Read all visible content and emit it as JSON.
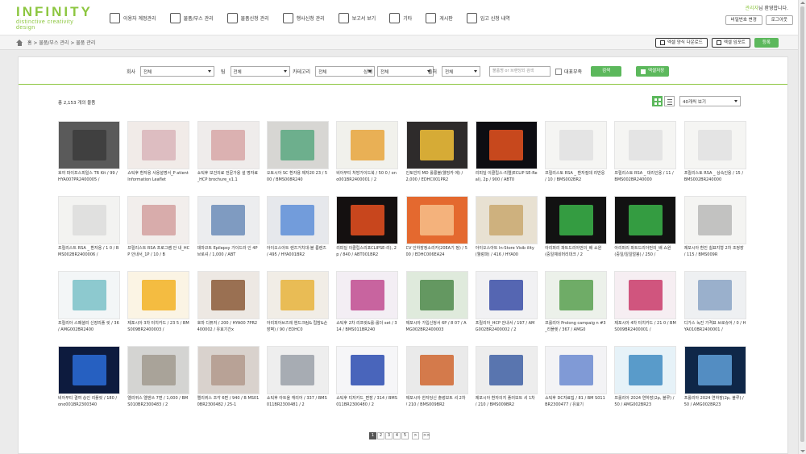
{
  "app": {
    "logo": "INFINITY",
    "tagline": "distinctive creativity design"
  },
  "nav": [
    {
      "label": "이용자 계정관리",
      "icon": "user-icon"
    },
    {
      "label": "물품/부스 관리",
      "icon": "map-icon"
    },
    {
      "label": "물품신청 관리",
      "icon": "box-icon"
    },
    {
      "label": "행사신청 관리",
      "icon": "calendar-icon"
    },
    {
      "label": "보고서 보기",
      "icon": "report-icon"
    },
    {
      "label": "기타",
      "icon": "tool-icon"
    },
    {
      "label": "게시판",
      "icon": "board-icon"
    },
    {
      "label": "입고 신청 내역",
      "icon": "cart-icon"
    }
  ],
  "user": {
    "name": "관리자",
    "welcome_suffix": "님 환영합니다.",
    "change_pw": "비밀번호 변경",
    "logout": "로그아웃"
  },
  "breadcrumb": "홈 > 물품/부스 관리 > 물품 관리",
  "toolbar": {
    "excel_download": "엑셀 양식 다운로드",
    "excel_import": "엑셀 임포트",
    "register": "등록"
  },
  "filters": {
    "company": {
      "label": "회사",
      "value": "전체"
    },
    "team": {
      "label": "팀",
      "value": "전체"
    },
    "category": {
      "label": "카테고리",
      "value": "전체"
    },
    "status": {
      "label": "상태",
      "value": "전체"
    },
    "warehouse": {
      "label": "출처",
      "value": "전체"
    },
    "search_placeholder": "물품명 or 브랜딩되 검색",
    "representative": "대표부족",
    "search_btn": "검색",
    "excel_btn": "엑셀저장"
  },
  "list": {
    "total": "총 2,153 개의 물품",
    "per_page": "40개씩 보기"
  },
  "products": [
    {
      "caption": "호야 파이프스피일스 TR Kit / 99 / HYA007PR2400005 /",
      "thumb": "#5a5a5a",
      "fg": "#3c3c3c"
    },
    {
      "caption": "쇼틱후 환자용 사용설명서_P atient Information Leaflet",
      "thumb": "#f1ebe8",
      "fg": "#d9b5ba"
    },
    {
      "caption": "쇼틱후 보건의료 전문가용 설 명자료_HCP brochure_v1.1",
      "thumb": "#efeceb",
      "fg": "#d7a7a7"
    },
    {
      "caption": "오토시아 SC 환자용 제자20 23 / 500 / BMS008R240",
      "thumb": "#d7d6d3",
      "fg": "#5aa880"
    },
    {
      "caption": "비아부티 처방가이드북 / 50 0 / ono001BR2400001 / 2",
      "thumb": "#f1f1ec",
      "fg": "#e8a53b"
    },
    {
      "caption": "인토빈지 MD 롤롱볼(웰빙카 에) / 2,000 / EDHC001PR2",
      "thumb": "#2e2b2b",
      "fg": "#f3c238"
    },
    {
      "caption": "리피딜 이클립스-리엘(ECLIP SE-Real), 2p / 900 / ABT0",
      "thumb": "#0d0d12",
      "fg": "#e95420"
    },
    {
      "caption": "프릴리스토 RSA _ 환자질데 리반응 / 10 / BMS002BR2",
      "thumb": "#f5f5f3",
      "fg": "#e1e1e1"
    },
    {
      "caption": "프릴리스토 RSA _ 대리인용 / 11 / BMS002BR240000",
      "thumb": "#f5f5f3",
      "fg": "#e1e1e1"
    },
    {
      "caption": "프릴리스토 RSA _ 상속인용 / 15 / BMS002BR240000",
      "thumb": "#f5f5f3",
      "fg": "#e1e1e1"
    },
    {
      "caption": "프릴리스트 RSA _ 환자용 / 1 0 / BMS002BR2400006 /",
      "thumb": "#f3f3f1",
      "fg": "#dcdcdc"
    },
    {
      "caption": "프릴리스트 RSA 프로그램 안 내_HCP 안내서_1P / 10 / B",
      "thumb": "#f2eeec",
      "fg": "#d3a0a0"
    },
    {
      "caption": "데마코트 Epilepsy 가이드라 인 4P 브로셔 / 1,000 / ABT",
      "thumb": "#ecedef",
      "fg": "#6c8cb9"
    },
    {
      "caption": "아이오스아트 렌즈거치대-블 름렌즈 / 495 / HYA001BR2",
      "thumb": "#e6e8ec",
      "fg": "#5d8ed8"
    },
    {
      "caption": "리피딜 이클립스리포CLIPSE-리), 2p / 840 / ABT001BR2",
      "thumb": "#141010",
      "fg": "#e85020"
    },
    {
      "caption": "CV 인하장정소리카(20EA기 정) / 500 / EDHC006EA24",
      "thumb": "#e4692f",
      "fg": "#f7c08a"
    },
    {
      "caption": "아이오스아트 In-Store Visib ility (웰렁파) / 416 / HYA00",
      "thumb": "#e8e1d2",
      "fg": "#c9a870"
    },
    {
      "caption": "아리퍼리 파트드리아먼의_배 쇼원 (중일예네머리대크 / 2",
      "thumb": "#121212",
      "fg": "#3bb54a"
    },
    {
      "caption": "아리퍼리 파트드리아먼의_배 쇼원 (중일/일일얼봉) / 250 /",
      "thumb": "#121212",
      "fg": "#3bb54a"
    },
    {
      "caption": "제포시아 환진 쉼표지형 2차 조정장 / 115 / BMS009R",
      "thumb": "#f4f4f2",
      "fg": "#b9b9b9"
    },
    {
      "caption": "프릴리아 스페셜리 신장리플 릿 / 36 / AMG002BR2400",
      "thumb": "#f3f6f7",
      "fg": "#7ac1c8"
    },
    {
      "caption": "제포시아 3차 터치카드 / 23 5 / BMS009BR2400003 /",
      "thumb": "#fbf4e4",
      "fg": "#f2b125"
    },
    {
      "caption": "호마 디퓨저 / 200 / HYA00 7PR2400002 / 유효기간x",
      "thumb": "#ede8e3",
      "fg": "#8b5a38"
    },
    {
      "caption": "아리피아브즈레 핸드크림& 립밤&손장벽) / 90 / EDHC0",
      "thumb": "#f1ede6",
      "fg": "#e7b33b"
    },
    {
      "caption": "쇼틱후 2차 리프릿&롤-롤더 set / 314 / BMS011BR240",
      "thumb": "#f3eef4",
      "fg": "#c04b8f"
    },
    {
      "caption": "제포시아 가입신청서 6P / 8 07 / AMG002BR2400003",
      "thumb": "#dfeadc",
      "fg": "#4f8a4b"
    },
    {
      "caption": "프릴리아_HCP 안내서 / 197 / AMG002BR2400002 / 2",
      "thumb": "#f1f1f3",
      "fg": "#3a4da6"
    },
    {
      "caption": "프롤리아 Prolong campaig n #3_리플렛 / 367 / AMG0",
      "thumb": "#ecf1ea",
      "fg": "#59a050"
    },
    {
      "caption": "제포시아 4차 터치카드 / 21 0 / BMS009BR2400001 /",
      "thumb": "#f6eef2",
      "fg": "#c93a6a"
    },
    {
      "caption": "디가스 녹진 가격표 브로슈어 / 0 / HYA010BR2400001 /",
      "thumb": "#eef0f2",
      "fg": "#8ba5c6"
    },
    {
      "caption": "비아부티 결여 승인 리플릿 / 180 / ono001BR2300340",
      "thumb": "#0d1b3e",
      "fg": "#2c6cd8"
    },
    {
      "caption": "엘리퀴스 엘엔쓰 7편 / 1,000 / BMS010BR2300483 / 2",
      "thumb": "#d4d4d2",
      "fg": "#a19a8f"
    },
    {
      "caption": "엘리퀴스 조각 6편 / 940 / B MS010BR2300482 / 25-1",
      "thumb": "#d9d2cd",
      "fg": "#b29a8c"
    },
    {
      "caption": "쇼틱후 아트올 캐리어 / 337 / BMS011BR2300481 / 2",
      "thumb": "#eeeeee",
      "fg": "#9aa0a8"
    },
    {
      "caption": "쇼틱후 티저카드_편장 / 314 / BMS011BR2300480 / 2",
      "thumb": "#f6f6f8",
      "fg": "#2a4bb0"
    },
    {
      "caption": "제포시아 한자당신 출렁보트 셔 2차 / 210 / BMS009BR2",
      "thumb": "#eaeaea",
      "fg": "#d0662f"
    },
    {
      "caption": "제포시아 환자의지 플러보트 셔 1차 / 210 / BMS009BR2",
      "thumb": "#ededed",
      "fg": "#3e5fa3"
    },
    {
      "caption": "쇼틱후 DC자료집 / 81 / BM S011BR2300477 / 유효기",
      "thumb": "#f3f3f5",
      "fg": "#6b8ad0"
    },
    {
      "caption": "프롤리아 2024 연하장(2p, 블루) / 50 / AMG002BR23",
      "thumb": "#e6f2f8",
      "fg": "#3f8cc2"
    },
    {
      "caption": "프롤리아 2024 연하장(2p, 블루) / 50 / AMG002BR23",
      "thumb": "#0f2748",
      "fg": "#5fa0d8"
    }
  ],
  "pagination": {
    "pages": [
      "1",
      "2",
      "3",
      "4",
      "5"
    ],
    "current": "1",
    "next": ">",
    "last": ">>"
  }
}
